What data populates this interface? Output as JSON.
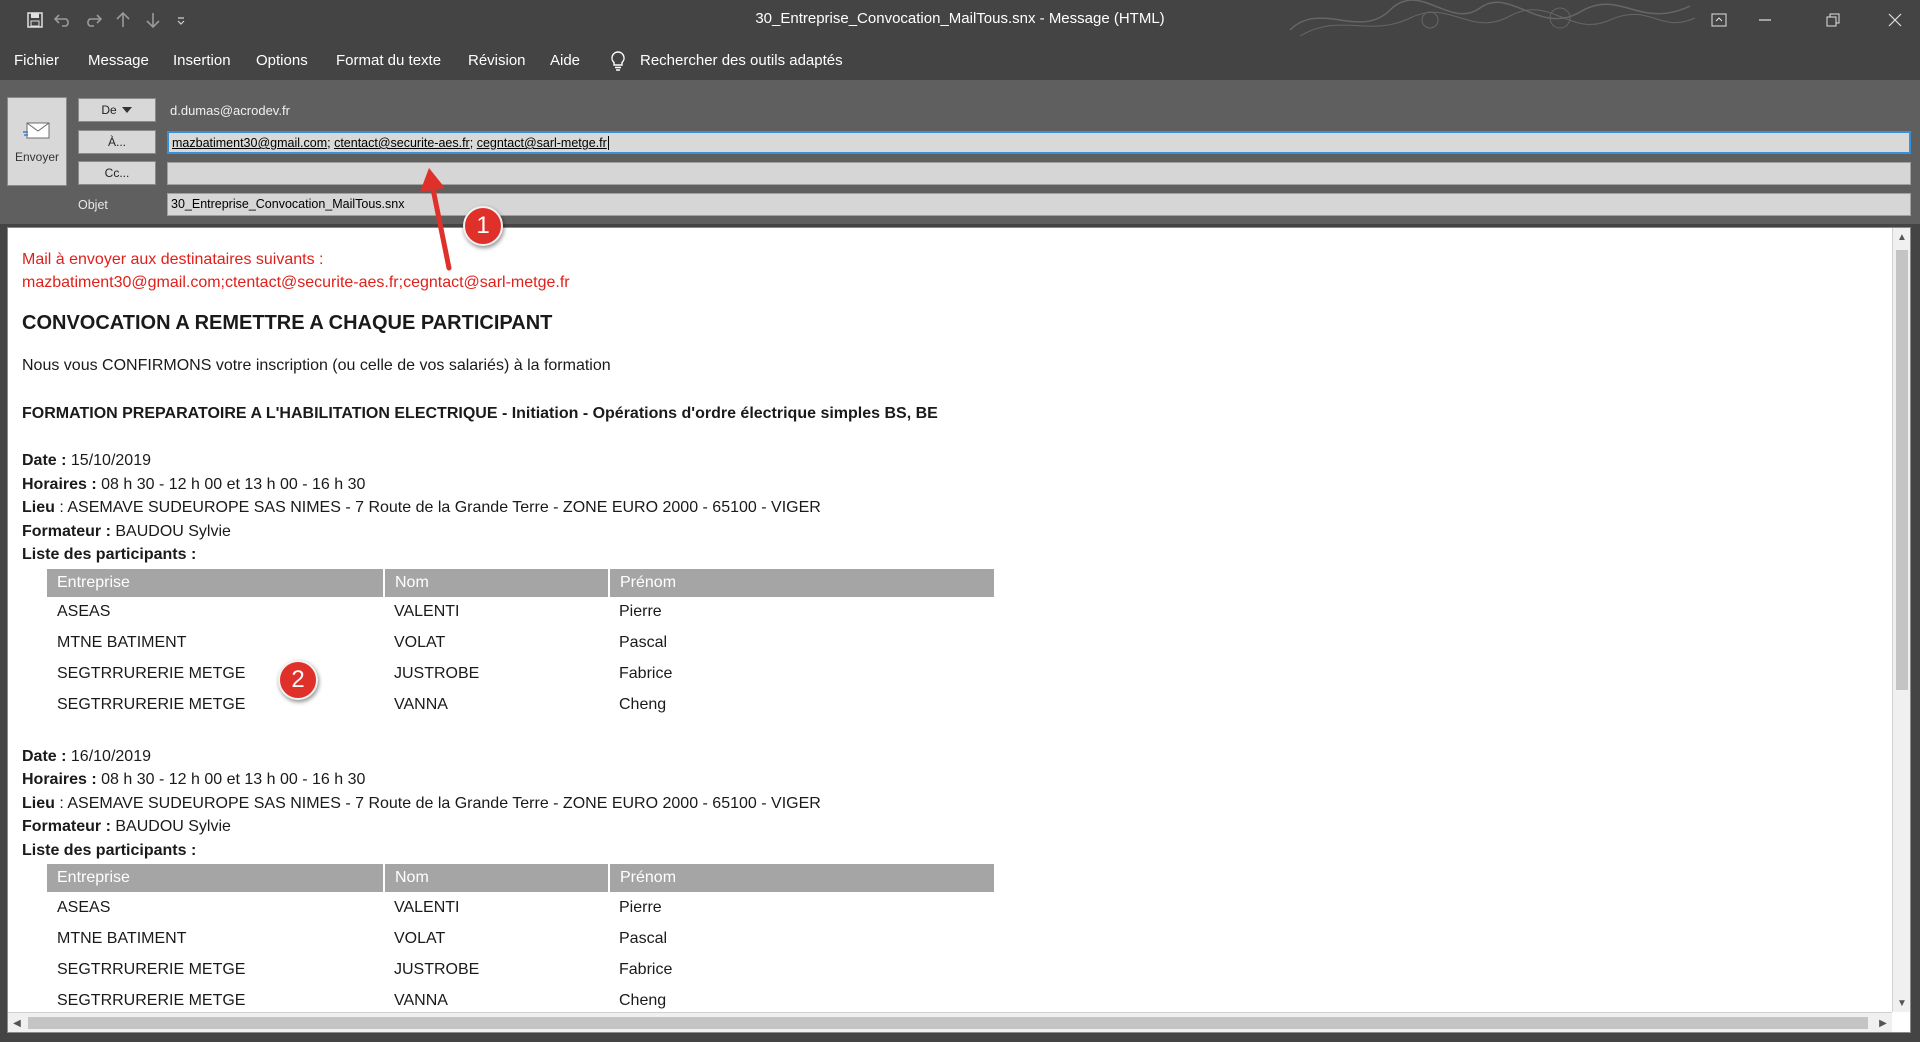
{
  "window": {
    "title": "30_Entreprise_Convocation_MailTous.snx  -  Message (HTML)"
  },
  "menu": [
    "Fichier",
    "Message",
    "Insertion",
    "Options",
    "Format du texte",
    "Révision",
    "Aide"
  ],
  "tell_me": "Rechercher des outils adaptés",
  "header": {
    "send_label": "Envoyer",
    "from_button": "De",
    "from_address": "d.dumas@acrodev.fr",
    "to_button": "À...",
    "to_recipients": [
      "mazbatiment30@gmail.com",
      "ctentact@securite-aes.fr",
      "cegntact@sarl-metge.fr"
    ],
    "cc_button": "Cc...",
    "subject_label": "Objet",
    "subject_value": "30_Entreprise_Convocation_MailTous.snx"
  },
  "body": {
    "red_line1": "Mail à envoyer aux destinataires suivants :",
    "red_line2": "mazbatiment30@gmail.com;ctentact@securite-aes.fr;cegntact@sarl-metge.fr",
    "heading": "CONVOCATION A REMETTRE A CHAQUE PARTICIPANT",
    "intro": "Nous vous CONFIRMONS votre inscription (ou celle de vos salariés) à la formation",
    "formation": "FORMATION PREPARATOIRE A L'HABILITATION ELECTRIQUE - Initiation - Opérations d'ordre électrique simples BS, BE",
    "labels": {
      "date": "Date :",
      "horaires": "Horaires :",
      "lieu": "Lieu",
      "lieu_sep": " : ",
      "formateur": "Formateur :",
      "participants": "Liste des participants :"
    },
    "columns": [
      "Entreprise",
      "Nom",
      "Prénom"
    ],
    "sessions": [
      {
        "date": "15/10/2019",
        "horaires": "08 h 30 - 12 h 00 et 13 h 00 - 16 h 30",
        "lieu": "ASEMAVE SUDEUROPE SAS NIMES - 7 Route de la Grande Terre - ZONE EURO 2000 - 65100 - VIGER",
        "formateur": "BAUDOU Sylvie",
        "rows": [
          [
            "ASEAS",
            "VALENTI",
            "Pierre"
          ],
          [
            "MTNE BATIMENT",
            "VOLAT",
            "Pascal"
          ],
          [
            "SEGTRRURERIE METGE",
            "JUSTROBE",
            "Fabrice"
          ],
          [
            "SEGTRRURERIE METGE",
            "VANNA",
            "Cheng"
          ]
        ]
      },
      {
        "date": "16/10/2019",
        "horaires": "08 h 30 - 12 h 00 et 13 h 00 - 16 h 30",
        "lieu": "ASEMAVE SUDEUROPE SAS NIMES - 7 Route de la Grande Terre - ZONE EURO 2000 - 65100 - VIGER",
        "formateur": "BAUDOU Sylvie",
        "rows": [
          [
            "ASEAS",
            "VALENTI",
            "Pierre"
          ],
          [
            "MTNE BATIMENT",
            "VOLAT",
            "Pascal"
          ],
          [
            "SEGTRRURERIE METGE",
            "JUSTROBE",
            "Fabrice"
          ],
          [
            "SEGTRRURERIE METGE",
            "VANNA",
            "Cheng"
          ]
        ]
      }
    ]
  },
  "annotations": [
    "1",
    "2"
  ],
  "colors": {
    "chrome": "#444444",
    "header": "#5f5f5f",
    "red_text": "#e0201b",
    "table_header": "#a5a5a5",
    "badge": "#e0302a",
    "focus": "#3b8fd8"
  }
}
